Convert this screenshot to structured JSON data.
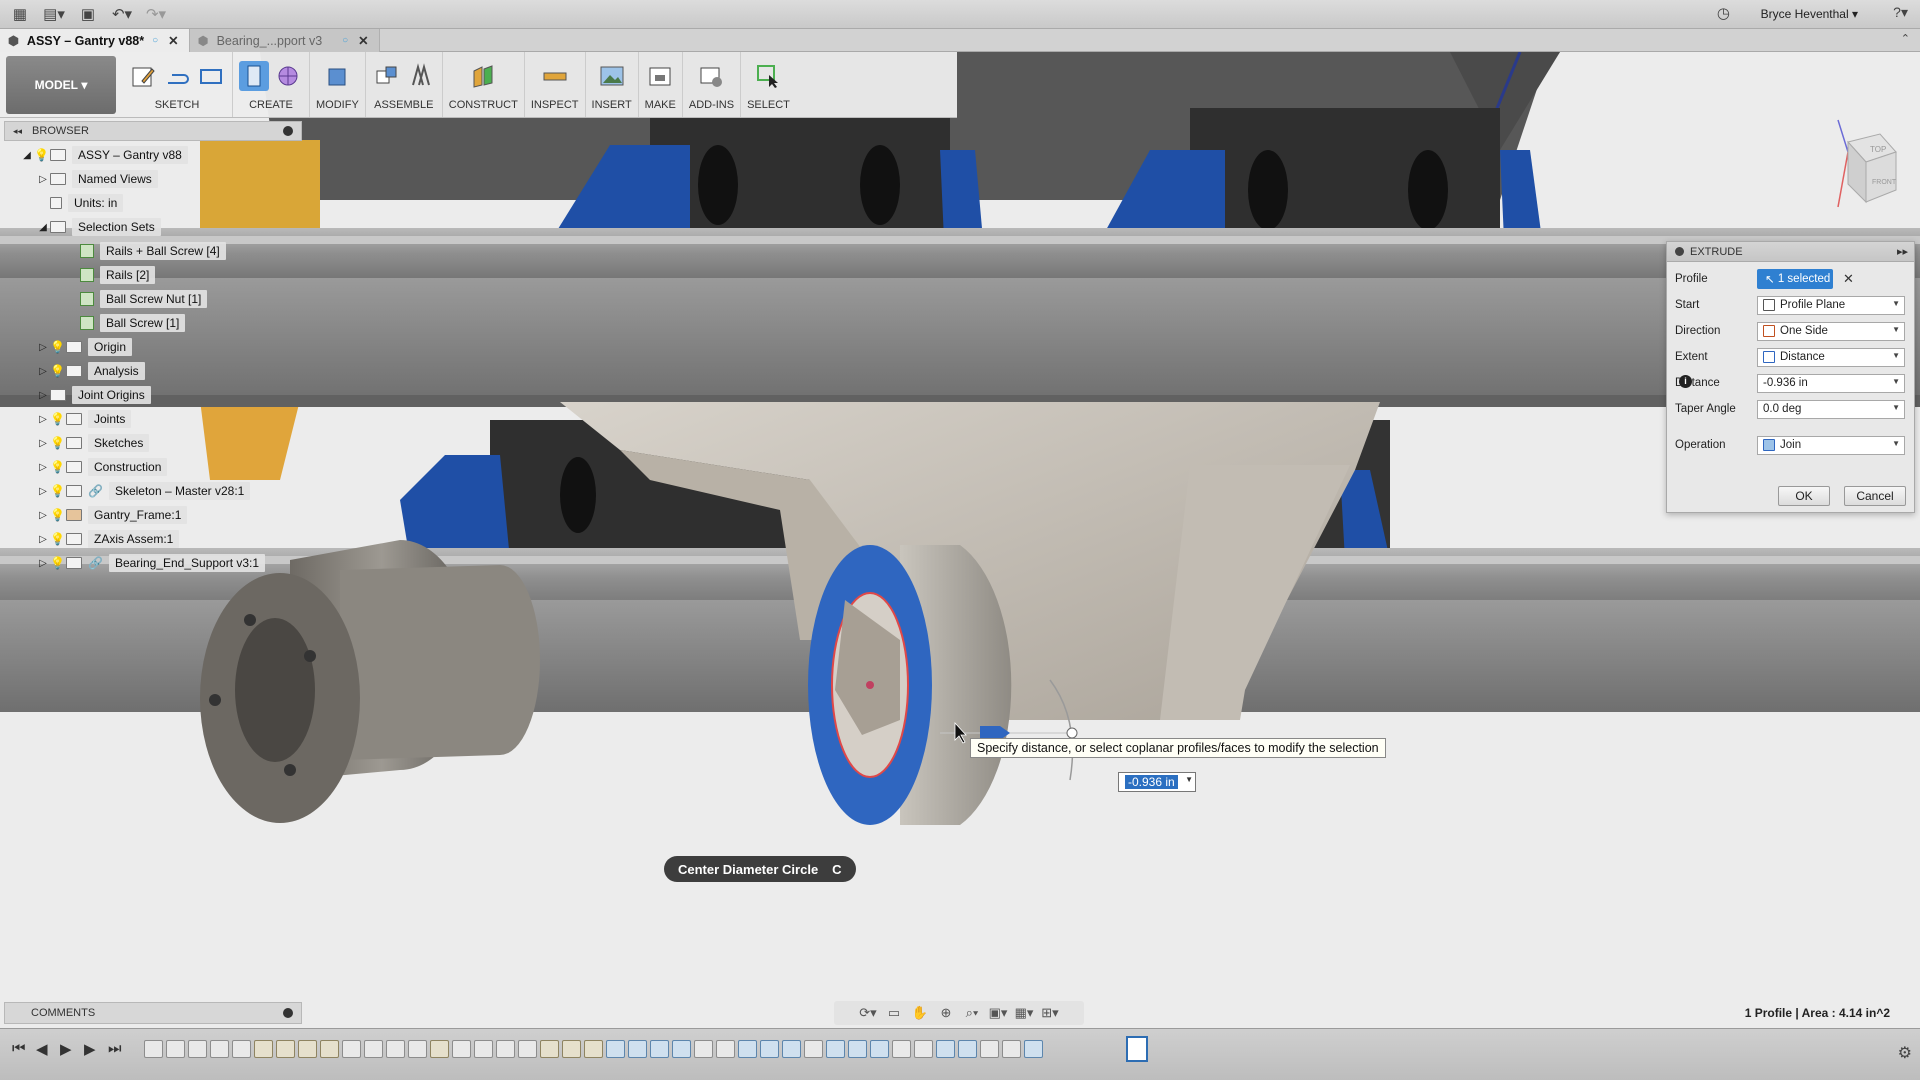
{
  "app": {
    "user_name": "Bryce Heventhal",
    "colors": {
      "accent": "#2f80d1",
      "blue_part": "#1f4fa6",
      "tooltip_bg": "#fffff6"
    }
  },
  "tabs": [
    {
      "label": "ASSY – Gantry v88*",
      "active": true
    },
    {
      "label": "Bearing_...pport v3",
      "active": false
    }
  ],
  "toolbar": {
    "mode_label": "MODEL",
    "groups": [
      {
        "label": "SKETCH"
      },
      {
        "label": "CREATE"
      },
      {
        "label": "MODIFY"
      },
      {
        "label": "ASSEMBLE"
      },
      {
        "label": "CONSTRUCT"
      },
      {
        "label": "INSPECT"
      },
      {
        "label": "INSERT"
      },
      {
        "label": "MAKE"
      },
      {
        "label": "ADD-INS"
      },
      {
        "label": "SELECT"
      }
    ]
  },
  "browser": {
    "title": "BROWSER",
    "items": [
      {
        "label": "ASSY – Gantry v88"
      },
      {
        "label": "Named Views"
      },
      {
        "label": "Units: in"
      },
      {
        "label": "Selection Sets"
      },
      {
        "label": "Rails + Ball Screw [4]"
      },
      {
        "label": "Rails [2]"
      },
      {
        "label": "Ball Screw Nut [1]"
      },
      {
        "label": "Ball Screw [1]"
      },
      {
        "label": "Origin"
      },
      {
        "label": "Analysis"
      },
      {
        "label": "Joint Origins"
      },
      {
        "label": "Joints"
      },
      {
        "label": "Sketches"
      },
      {
        "label": "Construction"
      },
      {
        "label": "Skeleton – Master v28:1"
      },
      {
        "label": "Gantry_Frame:1"
      },
      {
        "label": "ZAxis Assem:1"
      },
      {
        "label": "Bearing_End_Support v3:1"
      }
    ]
  },
  "comments": {
    "title": "COMMENTS"
  },
  "extrude": {
    "title": "EXTRUDE",
    "profile_label": "Profile",
    "profile_value": "1 selected",
    "start_label": "Start",
    "start_value": "Profile Plane",
    "direction_label": "Direction",
    "direction_value": "One Side",
    "extent_label": "Extent",
    "extent_value": "Distance",
    "distance_label": "Distance",
    "distance_value": "-0.936 in",
    "taper_label": "Taper Angle",
    "taper_value": "0.0 deg",
    "operation_label": "Operation",
    "operation_value": "Join",
    "ok_label": "OK",
    "cancel_label": "Cancel"
  },
  "canvas": {
    "tooltip": "Specify distance, or select coplanar profiles/faces to modify the selection",
    "distance_input": "-0.936 in",
    "command_pill_label": "Center Diameter Circle",
    "command_pill_key": "C"
  },
  "status": {
    "info": "1 Profile | Area : 4.14 in^2"
  },
  "viewcube": {
    "top": "TOP",
    "front": "FRONT"
  }
}
